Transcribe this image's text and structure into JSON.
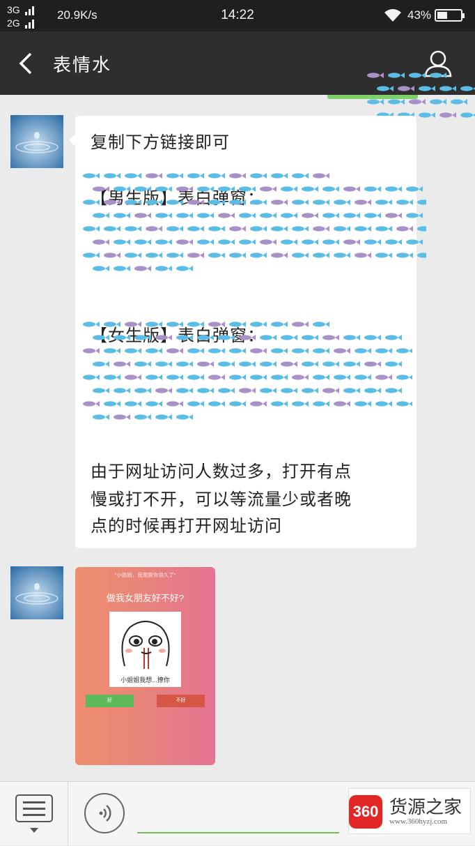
{
  "status_bar": {
    "network_1": "3G",
    "network_2": "2G",
    "speed": "20.9K/s",
    "time": "14:22",
    "battery_percent": "43%",
    "battery_level": 0.43
  },
  "header": {
    "back_icon": "chevron-left-icon",
    "title": "表情水",
    "profile_icon": "person-icon"
  },
  "messages": [
    {
      "type": "text",
      "lines": {
        "l1": "复制下方链接即可",
        "l2": "【男生版】表白弹窗：",
        "l3": "【女生版】表白弹窗：",
        "l4": "由于网址访问人数过多，打开有点",
        "l5": "慢或打不开，可以等流量少或者晚",
        "l6": "点的时候再打开网址访问"
      }
    },
    {
      "type": "image",
      "quote": "“小姐姐，我观察你很久了”",
      "question": "做我女朋友好不好?",
      "caption": "小姐姐我想...撩你",
      "yes_label": "好",
      "no_label": "不好"
    }
  ],
  "input_bar": {
    "menu_icon": "list-menu-icon",
    "voice_icon": "voice-icon"
  },
  "watermark": {
    "badge": "360",
    "name": "货源之家",
    "url": "www.360hyzj.com"
  },
  "colors": {
    "header_bg": "#2e2e2e",
    "chat_bg": "#ebebeb",
    "fish_blue": "#5bbde6",
    "fish_purple": "#a890c8",
    "accent_green": "#6fbf5d"
  }
}
